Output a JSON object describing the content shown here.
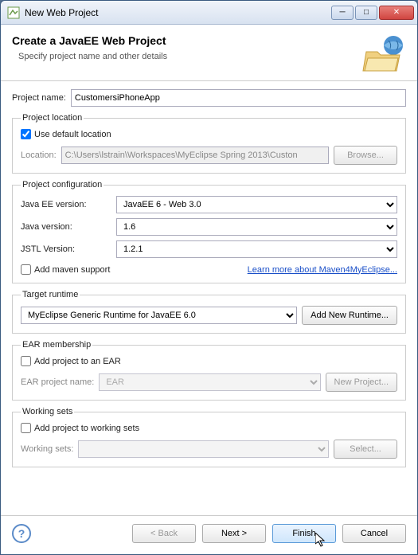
{
  "window": {
    "title": "New Web Project"
  },
  "header": {
    "title": "Create a JavaEE Web Project",
    "subtitle": "Specify project name and other details"
  },
  "project_name": {
    "label": "Project name:",
    "value": "CustomersiPhoneApp"
  },
  "location_group": {
    "legend": "Project location",
    "use_default_label": "Use default location",
    "use_default_checked": true,
    "location_label": "Location:",
    "location_value": "C:\\Users\\lstrain\\Workspaces\\MyEclipse Spring 2013\\Custon",
    "browse_label": "Browse..."
  },
  "config_group": {
    "legend": "Project configuration",
    "javaee_label": "Java EE version:",
    "javaee_value": "JavaEE 6 - Web 3.0",
    "java_label": "Java version:",
    "java_value": "1.6",
    "jstl_label": "JSTL Version:",
    "jstl_value": "1.2.1",
    "maven_label": "Add maven support",
    "maven_checked": false,
    "maven_link": "Learn more about Maven4MyEclipse..."
  },
  "runtime_group": {
    "legend": "Target runtime",
    "value": "MyEclipse Generic Runtime for JavaEE 6.0",
    "add_label": "Add New Runtime..."
  },
  "ear_group": {
    "legend": "EAR membership",
    "add_label": "Add project to an EAR",
    "add_checked": false,
    "name_label": "EAR project name:",
    "name_value": "EAR",
    "new_label": "New Project..."
  },
  "working_group": {
    "legend": "Working sets",
    "add_label": "Add project to working sets",
    "add_checked": false,
    "ws_label": "Working sets:",
    "select_label": "Select..."
  },
  "footer": {
    "back": "< Back",
    "next": "Next >",
    "finish": "Finish",
    "cancel": "Cancel"
  }
}
